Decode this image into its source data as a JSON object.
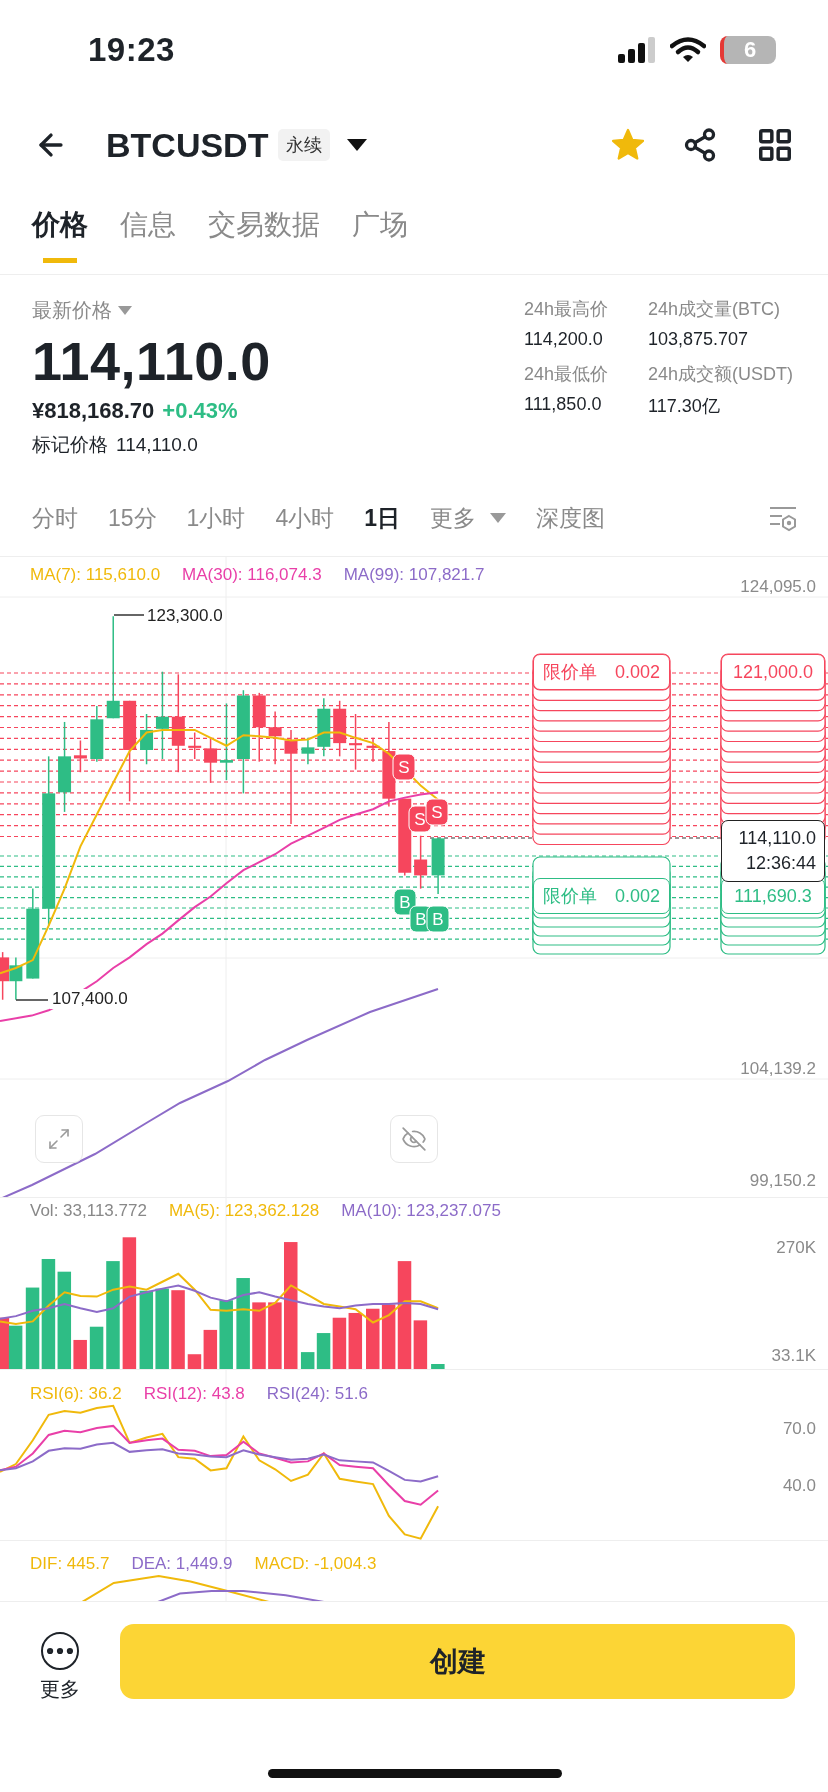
{
  "status_bar": {
    "time": "19:23",
    "battery": "6"
  },
  "header": {
    "symbol": "BTCUSDT",
    "badge": "永续",
    "favorite": true
  },
  "tabs": [
    {
      "label": "价格",
      "selected": true
    },
    {
      "label": "信息",
      "selected": false
    },
    {
      "label": "交易数据",
      "selected": false
    },
    {
      "label": "广场",
      "selected": false
    }
  ],
  "price": {
    "label": "最新价格",
    "last": "114,110.0",
    "cny": "¥818,168.70",
    "change": "+0.43%",
    "mark_label": "标记价格",
    "mark_price": "114,110.0"
  },
  "stats": [
    {
      "label": "24h最高价",
      "value": "114,200.0"
    },
    {
      "label": "24h成交量(BTC)",
      "value": "103,875.707"
    },
    {
      "label": "24h最低价",
      "value": "111,850.0"
    },
    {
      "label": "24h成交额(USDT)",
      "value": "117.30亿"
    }
  ],
  "intervals": [
    {
      "label": "分时",
      "selected": false,
      "dropdown": false
    },
    {
      "label": "15分",
      "selected": false,
      "dropdown": false
    },
    {
      "label": "1小时",
      "selected": false,
      "dropdown": false
    },
    {
      "label": "4小时",
      "selected": false,
      "dropdown": false
    },
    {
      "label": "1日",
      "selected": true,
      "dropdown": false
    },
    {
      "label": "更多",
      "selected": false,
      "dropdown": true
    },
    {
      "label": "深度图",
      "selected": false,
      "dropdown": false
    }
  ],
  "main_chart": {
    "legend": [
      {
        "label": "MA(7): 115,610.0",
        "color": "#f0b90b"
      },
      {
        "label": "MA(30): 116,074.3",
        "color": "#e93fa8"
      },
      {
        "label": "MA(99): 107,821.7",
        "color": "#8c6bc8"
      }
    ],
    "axis": [
      "124,095.0",
      "104,139.2",
      "99,150.2"
    ],
    "high_label": "123,300.0",
    "low_label": "107,400.0",
    "orders": [
      {
        "color": "#f6465d",
        "type": "限价单",
        "quantity": "0.002",
        "price": "121,000.0"
      },
      {
        "color": "#2ebd85",
        "type": "限价单",
        "quantity": "0.002",
        "price": "111,690.3"
      }
    ],
    "current": {
      "price": "114,110.0",
      "countdown": "12:36:44"
    },
    "markers": [
      {
        "kind": "sell",
        "label": "S"
      },
      {
        "kind": "sell",
        "label": "S"
      },
      {
        "kind": "sell",
        "label": "S"
      },
      {
        "kind": "buy",
        "label": "B"
      },
      {
        "kind": "buy",
        "label": "B"
      },
      {
        "kind": "buy",
        "label": "B"
      }
    ]
  },
  "volume": {
    "legend": [
      {
        "label": "Vol: 33,113.772",
        "color": "#888888"
      },
      {
        "label": "MA(5): 123,362.128",
        "color": "#f0b90b"
      },
      {
        "label": "MA(10): 123,237.075",
        "color": "#8c6bc8"
      }
    ],
    "axis": [
      "270K",
      "33.1K"
    ]
  },
  "rsi": {
    "legend": [
      {
        "label": "RSI(6): 36.2",
        "color": "#f0b90b"
      },
      {
        "label": "RSI(12): 43.8",
        "color": "#e93fa8"
      },
      {
        "label": "RSI(24): 51.6",
        "color": "#8c6bc8"
      }
    ],
    "axis": [
      "70.0",
      "40.0"
    ]
  },
  "macd": {
    "legend": [
      {
        "label": "DIF: 445.7",
        "color": "#f0b90b"
      },
      {
        "label": "DEA: 1,449.9",
        "color": "#8c6bc8"
      },
      {
        "label": "MACD: -1,004.3",
        "color": "#f0b90b"
      }
    ]
  },
  "bottom_bar": {
    "more_label": "更多",
    "create_label": "创建"
  }
}
